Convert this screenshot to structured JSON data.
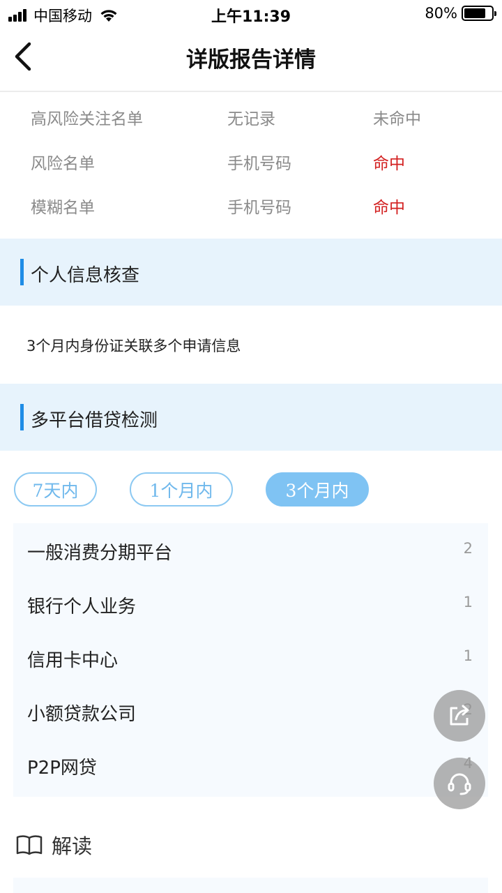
{
  "status_bar": {
    "carrier": "中国移动",
    "time": "上午11:39",
    "battery": "80%",
    "battery_level": 0.8
  },
  "nav": {
    "title": "详版报告详情",
    "back_icon": "chevron-left-icon"
  },
  "risk_rows": [
    {
      "name": "高风险关注名单",
      "type": "无记录",
      "result": "未命中",
      "hit": false
    },
    {
      "name": "风险名单",
      "type": "手机号码",
      "result": "命中",
      "hit": true
    },
    {
      "name": "模糊名单",
      "type": "手机号码",
      "result": "命中",
      "hit": true
    }
  ],
  "sections": {
    "personal": {
      "title": "个人信息核查",
      "text": "3个月内身份证关联多个申请信息"
    },
    "multi_platform": {
      "title": "多平台借贷检测"
    }
  },
  "tabs": [
    {
      "label": "7天内",
      "active": false
    },
    {
      "label": "1个月内",
      "active": false
    },
    {
      "label": "3个月内",
      "active": true
    }
  ],
  "platforms": [
    {
      "label": "一般消费分期平台",
      "count": "2"
    },
    {
      "label": "银行个人业务",
      "count": "1"
    },
    {
      "label": "信用卡中心",
      "count": "1"
    },
    {
      "label": "小额贷款公司",
      "count": "2"
    },
    {
      "label": "P2P网贷",
      "count": "4"
    }
  ],
  "interpret": {
    "label": "解读",
    "icon": "book-icon"
  },
  "floating": {
    "share_icon": "share-icon",
    "service_icon": "headset-icon"
  },
  "colors": {
    "accent": "#1e8ce6",
    "hit": "#d32020",
    "section_bg": "#e7f3fc",
    "tab_active": "#7fc3f3"
  }
}
